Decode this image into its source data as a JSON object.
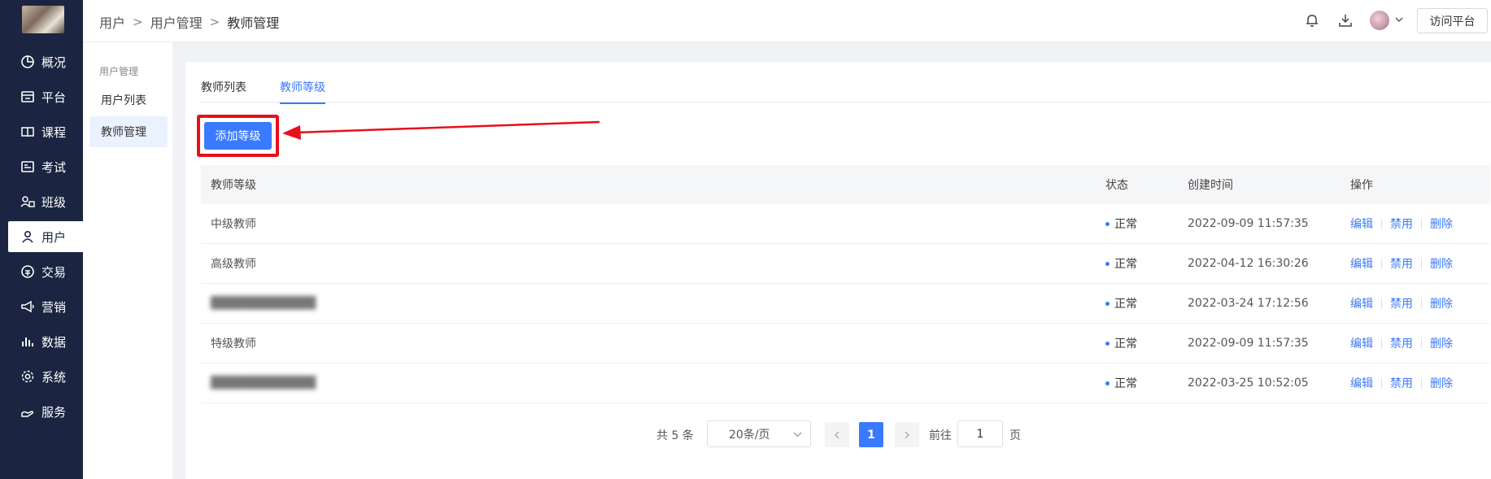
{
  "sidebar": {
    "items": [
      {
        "label": "概况",
        "icon": "pie-chart-icon"
      },
      {
        "label": "平台",
        "icon": "store-icon"
      },
      {
        "label": "课程",
        "icon": "book-icon"
      },
      {
        "label": "考试",
        "icon": "exam-icon"
      },
      {
        "label": "班级",
        "icon": "class-icon"
      },
      {
        "label": "用户",
        "icon": "user-icon"
      },
      {
        "label": "交易",
        "icon": "exchange-icon"
      },
      {
        "label": "营销",
        "icon": "megaphone-icon"
      },
      {
        "label": "数据",
        "icon": "bar-chart-icon"
      },
      {
        "label": "系统",
        "icon": "gear-icon"
      },
      {
        "label": "服务",
        "icon": "service-icon"
      }
    ],
    "active": "用户"
  },
  "subnav": {
    "title": "用户管理",
    "items": [
      "用户列表",
      "教师管理"
    ],
    "active": "教师管理"
  },
  "header": {
    "breadcrumb": [
      "用户",
      "用户管理",
      "教师管理"
    ],
    "visit_label": "访问平台"
  },
  "tabs": [
    "教师列表",
    "教师等级"
  ],
  "active_tab": "教师等级",
  "add_button": "添加等级",
  "table": {
    "headers": [
      "教师等级",
      "状态",
      "创建时间",
      "操作"
    ],
    "rows": [
      {
        "level": "中级教师",
        "status": "正常",
        "created": "2022-09-09 11:57:35",
        "blurred": false
      },
      {
        "level": "高级教师",
        "status": "正常",
        "created": "2022-04-12 16:30:26",
        "blurred": false
      },
      {
        "level": "",
        "status": "正常",
        "created": "2022-03-24 17:12:56",
        "blurred": true
      },
      {
        "level": "特级教师",
        "status": "正常",
        "created": "2022-09-09 11:57:35",
        "blurred": false
      },
      {
        "level": "",
        "status": "正常",
        "created": "2022-03-25 10:52:05",
        "blurred": true
      }
    ],
    "actions": [
      "编辑",
      "禁用",
      "删除"
    ]
  },
  "pagination": {
    "total": "共 5 条",
    "page_size": "20条/页",
    "current": "1",
    "goto_label": "前往",
    "goto_value": "1",
    "unit": "页"
  },
  "colors": {
    "primary": "#3a7afe",
    "sidebar": "#1b2541",
    "highlight": "#e8101a"
  }
}
